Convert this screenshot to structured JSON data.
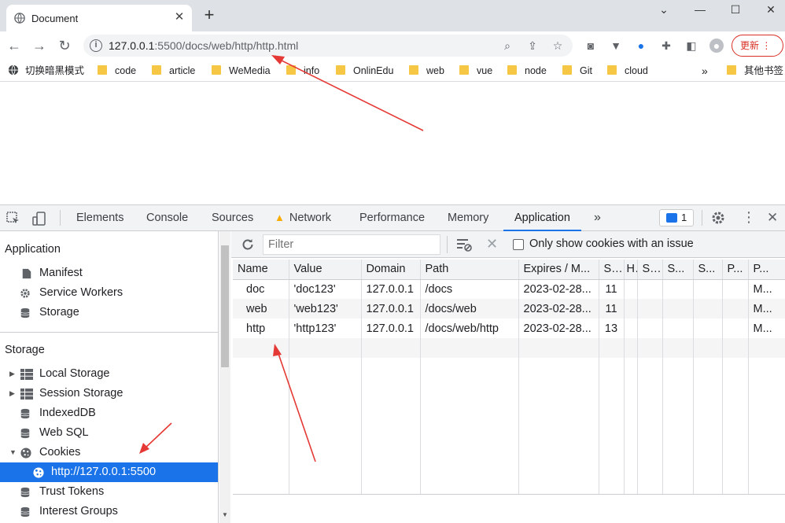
{
  "browser": {
    "tab_title": "Document",
    "url_host": "127.0.0.1",
    "url_path": ":5500/docs/web/http/http.html",
    "update_label": "更新",
    "bookmarks": [
      "切换暗黑模式",
      "code",
      "article",
      "WeMedia",
      "info",
      "OnlinEdu",
      "web",
      "vue",
      "node",
      "Git",
      "cloud"
    ],
    "bookmarks_more": "»",
    "other_bookmarks": "其他书签"
  },
  "devtools": {
    "tabs": [
      "Elements",
      "Console",
      "Sources",
      "Network",
      "Performance",
      "Memory",
      "Application"
    ],
    "active_tab": "Application",
    "more_tabs": "»",
    "issues_count": "1",
    "network_warning_icon": "warning-icon"
  },
  "sidebar": {
    "application_heading": "Application",
    "application_items": [
      "Manifest",
      "Service Workers",
      "Storage"
    ],
    "storage_heading": "Storage",
    "storage_items": [
      "Local Storage",
      "Session Storage",
      "IndexedDB",
      "Web SQL",
      "Cookies"
    ],
    "cookie_origin": "http://127.0.0.1:5500",
    "extra_items": [
      "Trust Tokens",
      "Interest Groups"
    ],
    "selected_color": "#1a73e8"
  },
  "cookies": {
    "filter_placeholder": "Filter",
    "only_issues_label": "Only show cookies with an issue",
    "columns": [
      "Name",
      "Value",
      "Domain",
      "Path",
      "Expires / M...",
      "S...",
      "H",
      "S...",
      "S...",
      "S...",
      "P...",
      "P..."
    ],
    "rows": [
      [
        "doc",
        "'doc123'",
        "127.0.0.1",
        "/docs",
        "2023-02-28...",
        "11",
        "",
        "",
        "",
        "",
        "",
        "M..."
      ],
      [
        "web",
        "'web123'",
        "127.0.0.1",
        "/docs/web",
        "2023-02-28...",
        "11",
        "",
        "",
        "",
        "",
        "",
        "M..."
      ],
      [
        "http",
        "'http123'",
        "127.0.0.1",
        "/docs/web/http",
        "2023-02-28...",
        "13",
        "",
        "",
        "",
        "",
        "",
        "M..."
      ]
    ]
  },
  "accent_color": "#1a73e8",
  "annotation_color": "#e53935"
}
